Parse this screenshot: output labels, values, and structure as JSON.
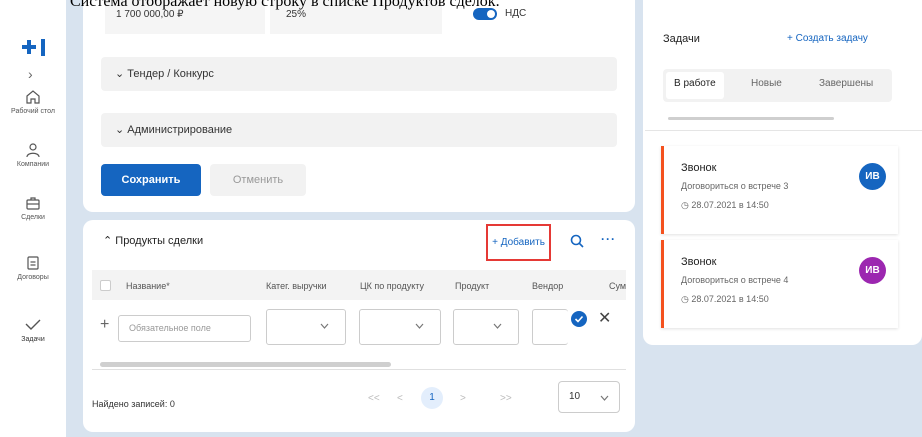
{
  "caption": "Система отображает новую строку в списке Продуктов сделок.",
  "nav": {
    "items": [
      {
        "label": "Рабочий стол",
        "icon": "home-icon"
      },
      {
        "label": "Компании",
        "icon": "person-icon"
      },
      {
        "label": "Сделки",
        "icon": "briefcase-icon"
      },
      {
        "label": "Договоры",
        "icon": "document-icon"
      },
      {
        "label": "Задачи",
        "icon": "check-icon"
      }
    ]
  },
  "form": {
    "amount": "1 700 000,00 ₽",
    "percent": "25%",
    "vat_label": "НДС",
    "vat_on": true,
    "section_tender": "Тендер / Конкурс",
    "section_admin": "Администрирование",
    "save_label": "Сохранить",
    "cancel_label": "Отменить"
  },
  "products": {
    "title": "Продукты сделки",
    "add_label": "+ Добавить",
    "columns": [
      "Название*",
      "Катег. выручки",
      "ЦК по продукту",
      "Продукт",
      "Вендор",
      "Сум"
    ],
    "new_row": {
      "name_placeholder": "Обязательное поле"
    },
    "found_label": "Найдено записей: 0",
    "pagination": {
      "first": "<<",
      "prev": "<",
      "current": "1",
      "next": ">",
      "last": ">>"
    },
    "page_size": "10"
  },
  "tasks": {
    "title": "Задачи",
    "create_label": "+ Создать задачу",
    "tabs": [
      "В работе",
      "Новые",
      "Завершены"
    ],
    "active_tab": 0,
    "items": [
      {
        "title": "Звонок",
        "desc": "Договориться о встрече 3",
        "date": "28.07.2021 в 14:50",
        "avatar": "ИВ",
        "avatar_color": "#1565c0"
      },
      {
        "title": "Звонок",
        "desc": "Договориться о встрече 4",
        "date": "28.07.2021 в 14:50",
        "avatar": "ИВ",
        "avatar_color": "#9c27b0"
      }
    ]
  },
  "colors": {
    "accent": "#1565c0",
    "highlight": "#e53935",
    "task_border": "#f4511e",
    "bg": "#d8e3ef"
  }
}
